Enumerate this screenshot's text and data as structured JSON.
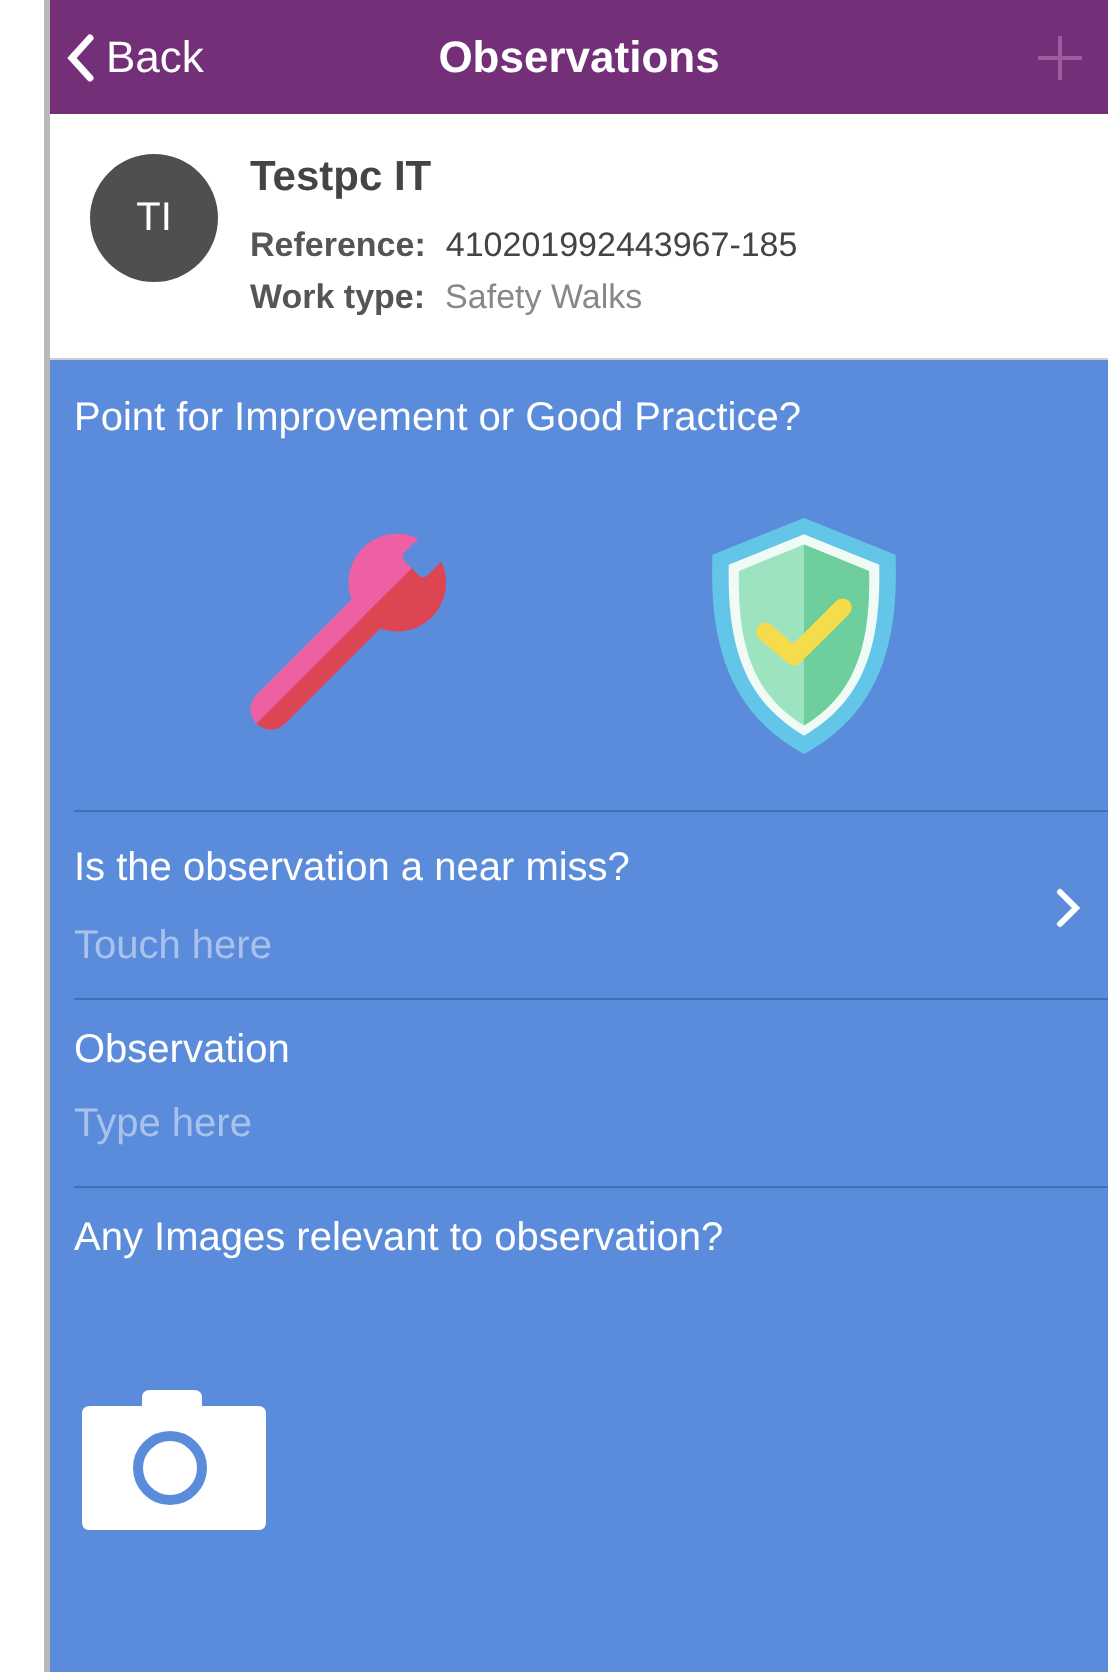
{
  "nav": {
    "back": "Back",
    "title": "Observations"
  },
  "header": {
    "initials": "TI",
    "name": "Testpc IT",
    "details": [
      {
        "label": "Reference:",
        "value": "410201992443967-185"
      },
      {
        "label": "Work type:",
        "value": "Safety Walks"
      }
    ]
  },
  "question": "Point for Improvement or Good Practice?",
  "fields": [
    {
      "kind": "picker",
      "label": "Is the observation a near miss?",
      "placeholder": "Touch here"
    },
    {
      "kind": "text",
      "label": "Observation",
      "placeholder": "Type here"
    }
  ],
  "images_label": "Any Images relevant to observation?"
}
